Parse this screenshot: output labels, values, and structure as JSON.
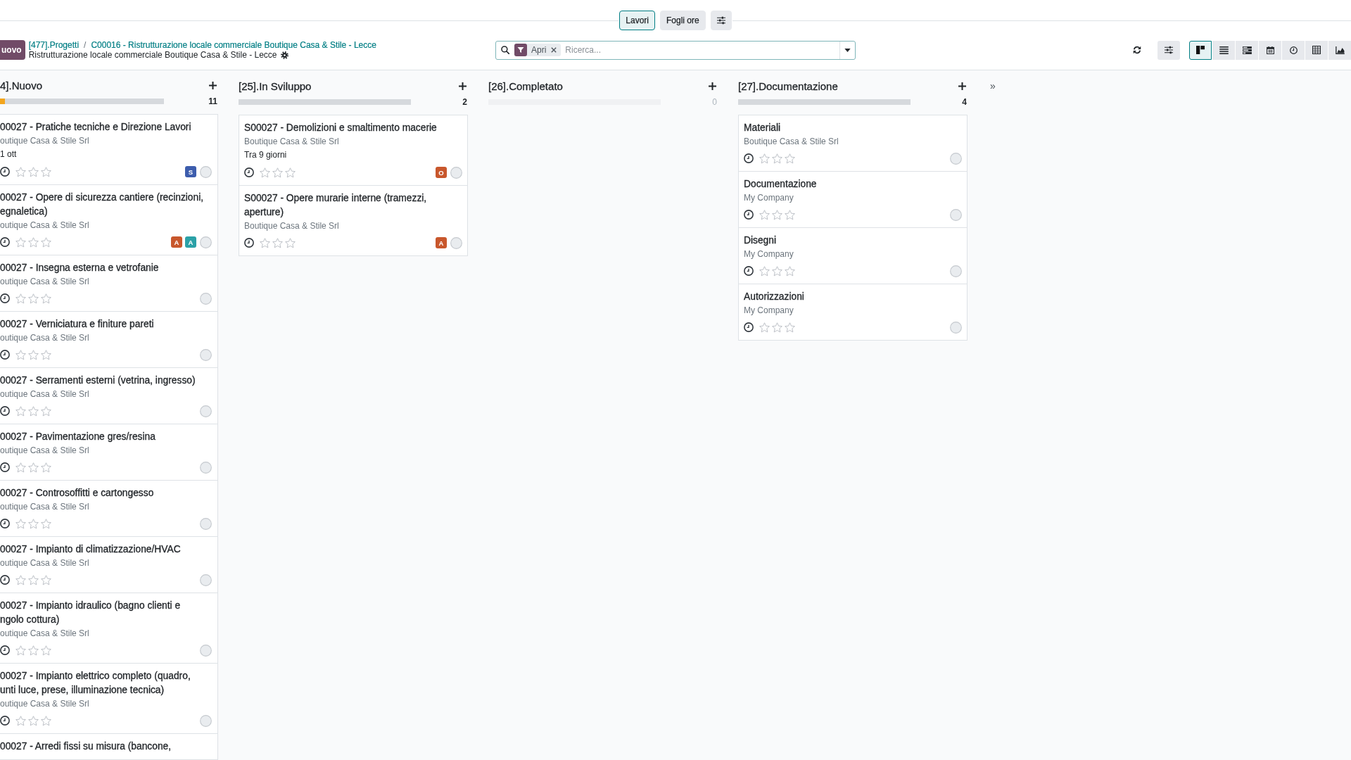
{
  "view_tabs": [
    {
      "label": "Lavori",
      "selected": true
    },
    {
      "label": "Fogli ore",
      "selected": false
    }
  ],
  "control_panel": {
    "new_button": "uovo",
    "breadcrumbs": [
      "[477].Progetti",
      "C00016 - Ristrutturazione locale commerciale Boutique Casa & Stile - Lecce"
    ],
    "separator": "/",
    "title": "Ristrutturazione locale commerciale Boutique Casa & Stile - Lecce",
    "search": {
      "facets": [
        {
          "label": "Apri"
        }
      ],
      "placeholder": "Ricerca..."
    },
    "view_switcher": [
      {
        "kind": "kanban",
        "selected": true
      },
      {
        "kind": "list",
        "selected": false
      },
      {
        "kind": "gantt",
        "selected": false
      },
      {
        "kind": "calendar",
        "selected": false
      },
      {
        "kind": "activity",
        "selected": false
      },
      {
        "kind": "pivot",
        "selected": false
      },
      {
        "kind": "graph",
        "selected": false
      }
    ]
  },
  "columns": [
    {
      "title": "4].Nuovo",
      "count": "11",
      "level": 0.03,
      "empty": false,
      "cards": [
        {
          "title": "00027 - Pratiche tecniche e Direzione Lavori",
          "customer": "outique Casa & Stile Srl",
          "date": "1 ott",
          "stars": 0,
          "avatars": [
            {
              "initial": "S",
              "color": "#3d5dad"
            }
          ]
        },
        {
          "title": "00027 - Opere di sicurezza cantiere (recinzioni, egnaletica)",
          "customer": "outique Casa & Stile Srl",
          "stars": 0,
          "avatars": [
            {
              "initial": "A",
              "color": "#c8572c"
            },
            {
              "initial": "A",
              "color": "#2ba1a7"
            }
          ]
        },
        {
          "title": "00027 - Insegna esterna e vetrofanie",
          "customer": "outique Casa & Stile Srl",
          "stars": 0
        },
        {
          "title": "00027 - Verniciatura e finiture pareti",
          "customer": "outique Casa & Stile Srl",
          "stars": 0
        },
        {
          "title": "00027 - Serramenti esterni (vetrina, ingresso)",
          "customer": "outique Casa & Stile Srl",
          "stars": 0
        },
        {
          "title": "00027 - Pavimentazione gres/resina",
          "customer": "outique Casa & Stile Srl",
          "stars": 0
        },
        {
          "title": "00027 - Controsoffitti e cartongesso",
          "customer": "outique Casa & Stile Srl",
          "stars": 0
        },
        {
          "title": "00027 - Impianto di climatizzazione/HVAC",
          "customer": "outique Casa & Stile Srl",
          "stars": 0
        },
        {
          "title": "00027 - Impianto idraulico (bagno clienti e ngolo cottura)",
          "customer": "outique Casa & Stile Srl",
          "stars": 0
        },
        {
          "title": "00027 - Impianto elettrico completo (quadro, unti luce, prese, illuminazione tecnica)",
          "customer": "outique Casa & Stile Srl",
          "stars": 0
        },
        {
          "title": "00027 - Arredi fissi su misura (bancone,"
        }
      ]
    },
    {
      "title": "[25].In Sviluppo",
      "count": "2",
      "empty": false,
      "cards": [
        {
          "title": "S00027 - Demolizioni e smaltimento macerie",
          "customer": "Boutique Casa & Stile Srl",
          "date": "Tra 9 giorni",
          "stars": 0,
          "avatars": [
            {
              "initial": "O",
              "color": "#c8572c"
            }
          ]
        },
        {
          "title": "S00027 - Opere murarie interne (tramezzi, aperture)",
          "customer": "Boutique Casa & Stile Srl",
          "stars": 0,
          "avatars": [
            {
              "initial": "A",
              "color": "#c8572c"
            }
          ]
        }
      ]
    },
    {
      "title": "[26].Completato",
      "count": "0",
      "empty": true
    },
    {
      "title": "[27].Documentazione",
      "count": "4",
      "empty": false,
      "cards": [
        {
          "title": "Materiali",
          "customer": "Boutique Casa & Stile Srl",
          "stars": 0
        },
        {
          "title": "Documentazione",
          "customer": "My Company",
          "stars": 0
        },
        {
          "title": "Disegni",
          "customer": "My Company",
          "stars": 0
        },
        {
          "title": "Autorizzazioni",
          "customer": "My Company",
          "stars": 0
        }
      ]
    }
  ],
  "fold_toggle": "»"
}
